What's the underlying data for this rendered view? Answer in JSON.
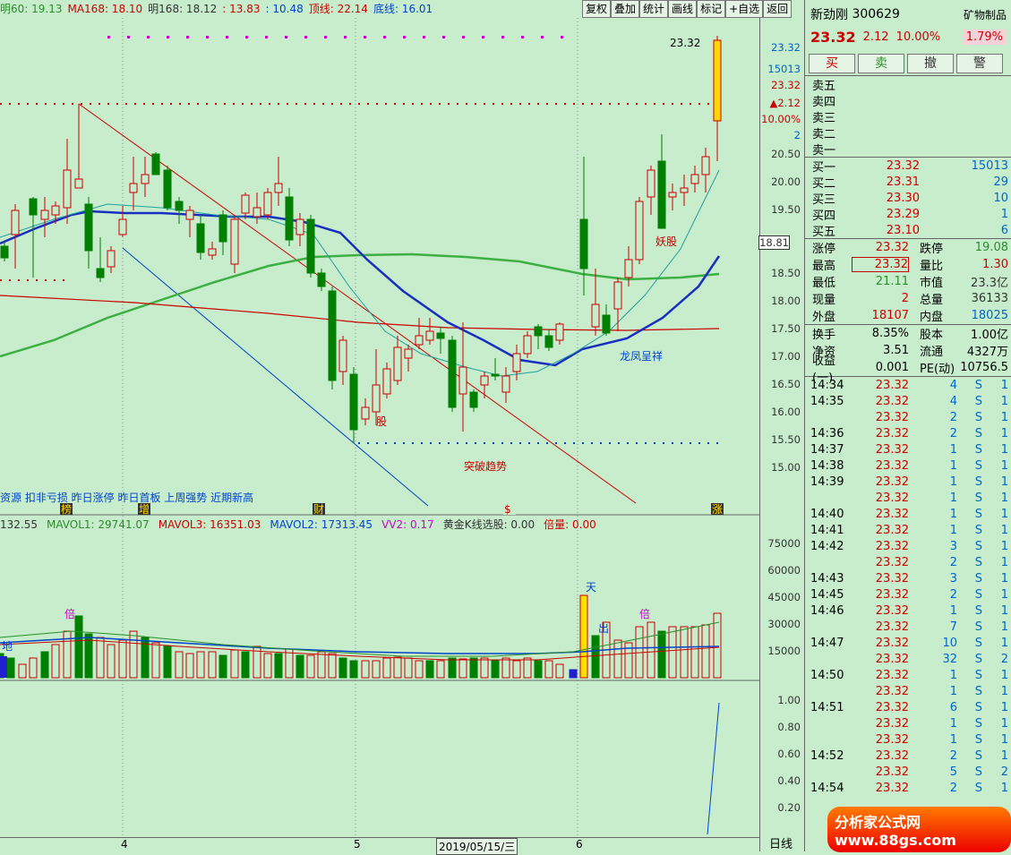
{
  "top_info": {
    "items": [
      {
        "label": "明60: 19.13",
        "color": "#2a8f2a"
      },
      {
        "label": "MA168: 18.10",
        "color": "#cc0000"
      },
      {
        "label": "明168: 18.12",
        "color": "#333333"
      },
      {
        "label": ": 13.83",
        "color": "#cc0000"
      },
      {
        "label": ": 10.48",
        "color": "#0044cc"
      },
      {
        "label": "顶线: 22.14",
        "color": "#cc0000"
      },
      {
        "label": "底线: 16.01",
        "color": "#0044cc"
      }
    ]
  },
  "toolbar": {
    "buttons": [
      "复权",
      "叠加",
      "统计",
      "画线",
      "标记",
      "+自选",
      "返回"
    ]
  },
  "stock": {
    "name": "新劲刚",
    "code": "300629",
    "sector": "矿物制品",
    "sector_change": "1.79%",
    "price": "23.32",
    "change": "2.12",
    "change_pct": "10.00%"
  },
  "trade_buttons": [
    "买",
    "卖",
    "撤",
    "警"
  ],
  "sell_levels": [
    {
      "label": "卖五",
      "price": "",
      "vol": ""
    },
    {
      "label": "卖四",
      "price": "",
      "vol": ""
    },
    {
      "label": "卖三",
      "price": "",
      "vol": ""
    },
    {
      "label": "卖二",
      "price": "",
      "vol": ""
    },
    {
      "label": "卖一",
      "price": "",
      "vol": ""
    }
  ],
  "buy_levels": [
    {
      "label": "买一",
      "price": "23.32",
      "vol": "15013"
    },
    {
      "label": "买二",
      "price": "23.31",
      "vol": "29"
    },
    {
      "label": "买三",
      "price": "23.30",
      "vol": "10"
    },
    {
      "label": "买四",
      "price": "23.29",
      "vol": "1"
    },
    {
      "label": "买五",
      "price": "23.10",
      "vol": "6"
    }
  ],
  "stats1": [
    {
      "l": "涨停",
      "v": "23.32",
      "l2": "跌停",
      "v2": "19.08"
    },
    {
      "l": "最高",
      "v": "23.32",
      "l2": "量比",
      "v2": "1.30"
    },
    {
      "l": "最低",
      "v": "21.11",
      "l2": "市值",
      "v2": "23.3亿"
    },
    {
      "l": "现量",
      "v": "2",
      "l2": "总量",
      "v2": "36133"
    },
    {
      "l": "外盘",
      "v": "18107",
      "l2": "内盘",
      "v2": "18025"
    }
  ],
  "stats2": [
    {
      "l": "换手",
      "v": "8.35%",
      "l2": "股本",
      "v2": "1.00亿"
    },
    {
      "l": "净资",
      "v": "3.51",
      "l2": "流通",
      "v2": "4327万"
    },
    {
      "l": "收益(一)",
      "v": "0.001",
      "l2": "PE(动)",
      "v2": "10756.5"
    }
  ],
  "ticks": [
    {
      "t": "14:34",
      "p": "23.32",
      "q": "4",
      "s": "S",
      "n": "1"
    },
    {
      "t": "14:35",
      "p": "23.32",
      "q": "4",
      "s": "S",
      "n": "1"
    },
    {
      "t": "",
      "p": "23.32",
      "q": "2",
      "s": "S",
      "n": "1"
    },
    {
      "t": "14:36",
      "p": "23.32",
      "q": "2",
      "s": "S",
      "n": "1"
    },
    {
      "t": "14:37",
      "p": "23.32",
      "q": "1",
      "s": "S",
      "n": "1"
    },
    {
      "t": "14:38",
      "p": "23.32",
      "q": "1",
      "s": "S",
      "n": "1"
    },
    {
      "t": "14:39",
      "p": "23.32",
      "q": "1",
      "s": "S",
      "n": "1"
    },
    {
      "t": "",
      "p": "23.32",
      "q": "1",
      "s": "S",
      "n": "1"
    },
    {
      "t": "14:40",
      "p": "23.32",
      "q": "1",
      "s": "S",
      "n": "1"
    },
    {
      "t": "14:41",
      "p": "23.32",
      "q": "1",
      "s": "S",
      "n": "1"
    },
    {
      "t": "14:42",
      "p": "23.32",
      "q": "3",
      "s": "S",
      "n": "1"
    },
    {
      "t": "",
      "p": "23.32",
      "q": "2",
      "s": "S",
      "n": "1"
    },
    {
      "t": "14:43",
      "p": "23.32",
      "q": "3",
      "s": "S",
      "n": "1"
    },
    {
      "t": "14:45",
      "p": "23.32",
      "q": "2",
      "s": "S",
      "n": "1"
    },
    {
      "t": "14:46",
      "p": "23.32",
      "q": "1",
      "s": "S",
      "n": "1"
    },
    {
      "t": "",
      "p": "23.32",
      "q": "7",
      "s": "S",
      "n": "1"
    },
    {
      "t": "14:47",
      "p": "23.32",
      "q": "10",
      "s": "S",
      "n": "1"
    },
    {
      "t": "",
      "p": "23.32",
      "q": "32",
      "s": "S",
      "n": "2"
    },
    {
      "t": "14:50",
      "p": "23.32",
      "q": "1",
      "s": "S",
      "n": "1"
    },
    {
      "t": "",
      "p": "23.32",
      "q": "1",
      "s": "S",
      "n": "1"
    },
    {
      "t": "14:51",
      "p": "23.32",
      "q": "6",
      "s": "S",
      "n": "1"
    },
    {
      "t": "",
      "p": "23.32",
      "q": "1",
      "s": "S",
      "n": "1"
    },
    {
      "t": "",
      "p": "23.32",
      "q": "1",
      "s": "S",
      "n": "1"
    },
    {
      "t": "14:52",
      "p": "23.32",
      "q": "2",
      "s": "S",
      "n": "1"
    },
    {
      "t": "",
      "p": "23.32",
      "q": "5",
      "s": "S",
      "n": "2"
    },
    {
      "t": "14:54",
      "p": "23.32",
      "q": "2",
      "s": "S",
      "n": "1"
    }
  ],
  "price_axis": [
    "23.32",
    "15013",
    "23.32",
    "▲2.12",
    "10.00%",
    "2",
    "20.50",
    "20.00",
    "19.50",
    "18.81",
    "18.50",
    "18.00",
    "17.50",
    "17.00",
    "16.50",
    "16.00",
    "15.50",
    "15.00"
  ],
  "vol_axis": [
    "75000",
    "60000",
    "45000",
    "30000",
    "15000"
  ],
  "ind_axis": [
    "1.00",
    "0.80",
    "0.60",
    "0.40",
    "0.20"
  ],
  "annotations": {
    "peak": "23.32",
    "yaojian": "妖股",
    "longfeng": "龙凤呈祥",
    "tupo": "突破趋势",
    "gu": "股",
    "tian": "天",
    "chu": "出",
    "bei1": "倍",
    "bei2": "倍",
    "di": "地"
  },
  "strategy_line": "资源 扣非亏损 昨日涨停 昨日首板 上周强势 近期新高",
  "vol_line": [
    {
      "label": "132.55",
      "color": "#333"
    },
    {
      "label": "MAVOL1: 29741.07",
      "color": "#2a8f2a"
    },
    {
      "label": "MAVOL3: 16351.03",
      "color": "#cc0000"
    },
    {
      "label": "MAVOL2: 17313.45",
      "color": "#0044cc"
    },
    {
      "label": "VV2: 0.17",
      "color": "#cc00cc"
    },
    {
      "label": "黄金K线选股: 0.00",
      "color": "#333"
    },
    {
      "label": "倍量: 0.00",
      "color": "#cc0000"
    }
  ],
  "dates": [
    "4",
    "5",
    "2019/05/15/三",
    "6"
  ],
  "period": "日线",
  "logo": "分析家公式网 www.88gs.com",
  "markers": [
    "榜",
    "增",
    "财",
    "$",
    "涨"
  ]
}
